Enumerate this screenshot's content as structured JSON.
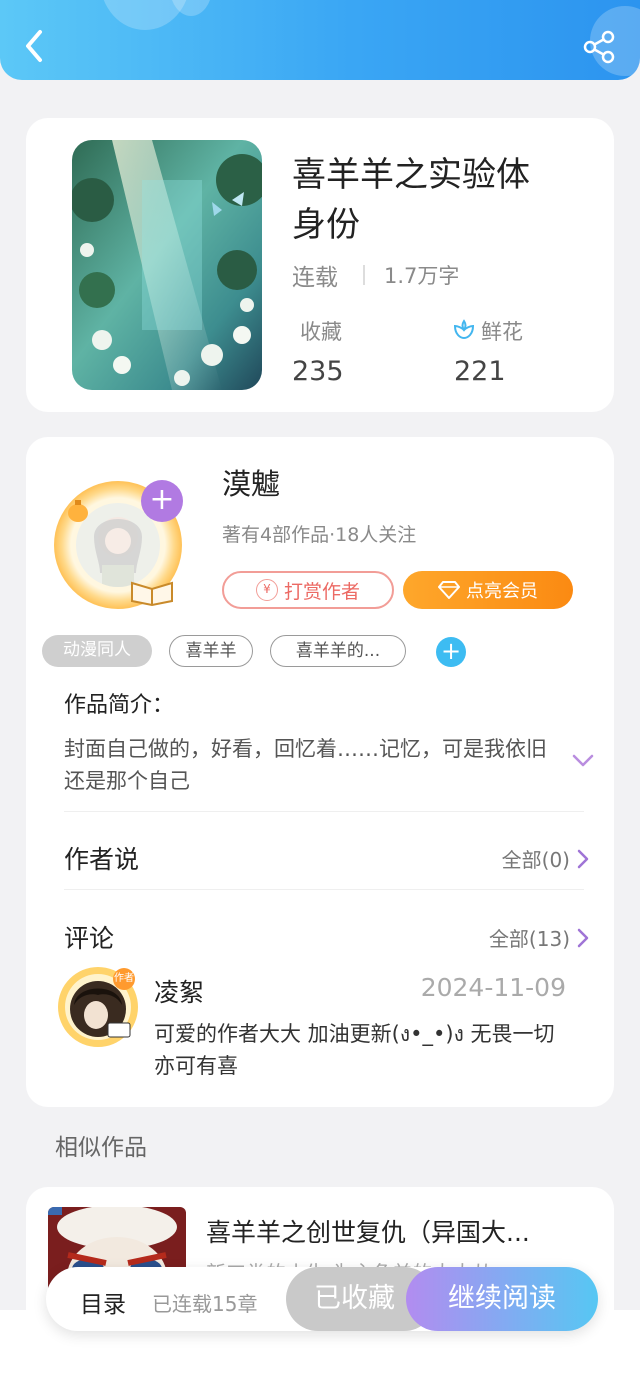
{
  "book": {
    "title_line1": "喜羊羊之实验体",
    "title_line2": "身份",
    "status": "连载",
    "word_count": "1.7万字",
    "favorites_label": "收藏",
    "favorites_count": "235",
    "flowers_label": "鲜花",
    "flowers_count": "221"
  },
  "author": {
    "name": "漠魖",
    "meta": "著有4部作品·18人关注",
    "follow_symbol": "+",
    "tip_label": "打赏作者",
    "tip_symbol": "¥",
    "vip_label": "点亮会员"
  },
  "tags": [
    "动漫同人",
    "喜羊羊",
    "喜羊羊的..."
  ],
  "tag_add_symbol": "+",
  "intro": {
    "label": "作品简介：",
    "text": "封面自己做的，好看，回忆着……记忆，可是我依旧还是那个自己"
  },
  "author_says": {
    "label": "作者说",
    "link": "全部(0)"
  },
  "comments": {
    "label": "评论",
    "link": "全部(13)",
    "items": [
      {
        "user": "凌絮",
        "date": "2024-11-09",
        "text": "可爱的作者大大 加油更新(ง•_•)ง 无畏一切 亦可有喜",
        "badge": "作者"
      }
    ]
  },
  "similar": {
    "label": "相似作品",
    "items": [
      {
        "title": "喜羊羊之创世复仇（异国大...",
        "subtitle": "新工类的小生   为主角羊的大大从"
      }
    ]
  },
  "bottom_bar": {
    "toc_label": "目录",
    "chapter_status": "已连载15章",
    "collected_label": "已收藏",
    "read_label": "继续阅读"
  },
  "colors": {
    "header_gradient_start": "#5cc8f7",
    "header_gradient_end": "#2c94ef",
    "tip_color": "#ec6a64",
    "vip_color": "#fb8a12",
    "follow_color": "#b17ae2",
    "read_gradient_start": "#b28cf0",
    "read_gradient_end": "#56c7f3",
    "collected_bg": "#c9c9c9"
  }
}
